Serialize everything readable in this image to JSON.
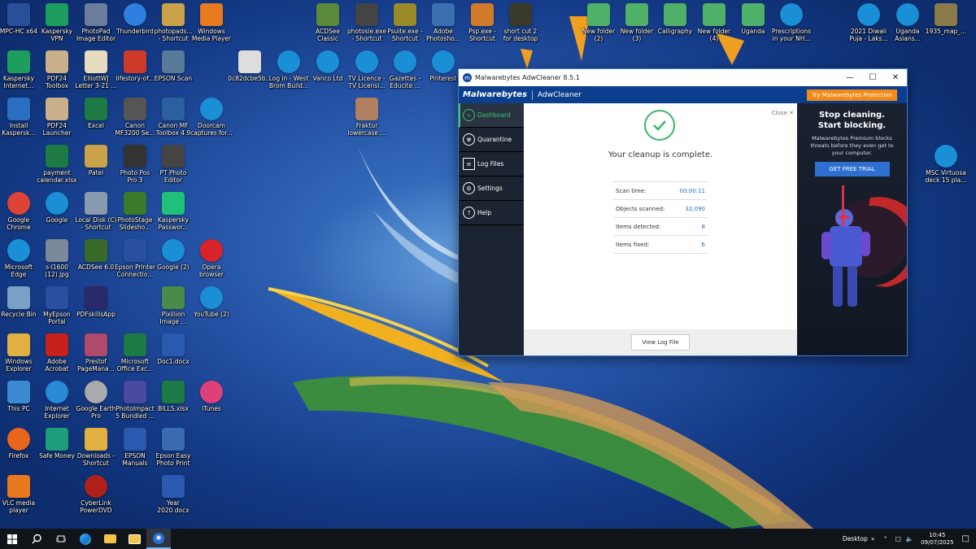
{
  "window": {
    "title": "Malwarebytes AdwCleaner 8.5.1",
    "brand": "Malwarebytes",
    "product": "AdwCleaner",
    "try_button": "Try Malwarebytes Protection",
    "nav": [
      {
        "label": "Dashboard",
        "icon": "dashboard-icon",
        "active": true
      },
      {
        "label": "Quarantine",
        "icon": "quarantine-icon",
        "active": false
      },
      {
        "label": "Log Files",
        "icon": "log-files-icon",
        "active": false
      },
      {
        "label": "Settings",
        "icon": "settings-icon",
        "active": false
      },
      {
        "label": "Help",
        "icon": "help-icon",
        "active": false
      }
    ],
    "close_link": "Close",
    "status": "Your cleanup is complete.",
    "stats": [
      {
        "label": "Scan time:",
        "value": "00:00:11"
      },
      {
        "label": "Objects scanned:",
        "value": "32,090"
      },
      {
        "label": "Items detected:",
        "value": "8"
      },
      {
        "label": "Items fixed:",
        "value": "6"
      }
    ],
    "view_log_button": "View Log File",
    "ad": {
      "headline1": "Stop cleaning.",
      "headline2": "Start blocking.",
      "body": "Malwarebytes Premium blocks threats before they even get to your computer.",
      "cta": "GET FREE TRIAL"
    },
    "colors": {
      "header": "#0b3e8c",
      "accent_green": "#3ab66a",
      "try_orange": "#f08a18",
      "sidebar": "#1c2431"
    }
  },
  "desktop_icons": [
    {
      "label": "MPC-HC x64",
      "icon": "mpc-hc-icon",
      "color": "#2a4f9a"
    },
    {
      "label": "Kaspersky\nVPN",
      "icon": "kaspersky-vpn-icon",
      "color": "#1e9e5e"
    },
    {
      "label": "PhotoPad\nImage Editor",
      "icon": "photopad-icon",
      "color": "#6a7d9c"
    },
    {
      "label": "Thunderbird",
      "icon": "thunderbird-icon",
      "color": "#2f7fe0"
    },
    {
      "label": "photopads...\n- Shortcut",
      "icon": "folder-icon",
      "color": "#c9a24a"
    },
    {
      "label": "Windows\nMedia Player",
      "icon": "media-player-icon",
      "color": "#e8791e"
    },
    {
      "label": "ACDSee\nClassic",
      "icon": "acdsee-icon",
      "color": "#5a8a3a"
    },
    {
      "label": "photosie.exe\n- Shortcut",
      "icon": "eye-icon",
      "color": "#444"
    },
    {
      "label": "Psuite.exe -\nShortcut",
      "icon": "psuite-icon",
      "color": "#9a8a2a"
    },
    {
      "label": "Adobe\nPhotosho...",
      "icon": "camera-icon",
      "color": "#3a6fb0"
    },
    {
      "label": "Psp.exe -\nShortcut",
      "icon": "psp-icon",
      "color": "#d07a2a"
    },
    {
      "label": "short cut 2\nfor desktop",
      "icon": "shortcut-icon",
      "color": "#3a3a2a"
    },
    {
      "label": "New folder\n(2)",
      "icon": "folder-icon",
      "color": "#4fb06a"
    },
    {
      "label": "New folder\n(3)",
      "icon": "folder-icon",
      "color": "#4fb06a"
    },
    {
      "label": "Calligraphy",
      "icon": "folder-icon",
      "color": "#4fb06a"
    },
    {
      "label": "New folder\n(4)",
      "icon": "folder-icon",
      "color": "#4fb06a"
    },
    {
      "label": "Uganda",
      "icon": "folder-icon",
      "color": "#4fb06a"
    },
    {
      "label": "Prescriptions\nin your NH...",
      "icon": "edge-icon",
      "color": "#1a8fd6"
    },
    {
      "label": "2021 Diwali\nPuja - Laks...",
      "icon": "edge-icon",
      "color": "#1a8fd6"
    },
    {
      "label": "Uganda\nAsians...",
      "icon": "edge-icon",
      "color": "#1a8fd6"
    },
    {
      "label": "1935_map_...",
      "icon": "map-icon",
      "color": "#8a7a4a"
    },
    {
      "label": "Kaspersky\nInternet...",
      "icon": "kaspersky-icon",
      "color": "#1e9e5e"
    },
    {
      "label": "PDF24\nToolbox",
      "icon": "pdf24-icon",
      "color": "#c9b08a"
    },
    {
      "label": "ElliottWJ\nLetter 3-21 ...",
      "icon": "document-icon",
      "color": "#e8dcc0"
    },
    {
      "label": "lifestory-of...",
      "icon": "pdf-icon",
      "color": "#d03a2a"
    },
    {
      "label": "EPSON Scan",
      "icon": "scanner-icon",
      "color": "#5a7a9a"
    },
    {
      "label": "0c82dcbe5b...",
      "icon": "image-icon",
      "color": "#ddd"
    },
    {
      "label": "Log in - West\nBrom Build...",
      "icon": "edge-icon",
      "color": "#1a8fd6"
    },
    {
      "label": "Vanco Ltd",
      "icon": "edge-icon",
      "color": "#1a8fd6"
    },
    {
      "label": "TV Licence -\nTV Licensi...",
      "icon": "edge-icon",
      "color": "#1a8fd6"
    },
    {
      "label": "Gazettes -\nEducite ...",
      "icon": "edge-icon",
      "color": "#1a8fd6"
    },
    {
      "label": "Pinterest",
      "icon": "edge-icon",
      "color": "#1a8fd6"
    },
    {
      "label": "Install\nKaspersk...",
      "icon": "installer-icon",
      "color": "#2a6fc0"
    },
    {
      "label": "PDF24\nLauncher",
      "icon": "pdf24-icon",
      "color": "#c9b08a"
    },
    {
      "label": "Excel",
      "icon": "excel-icon",
      "color": "#1d7a45"
    },
    {
      "label": "Canon\nMF3200 Se...",
      "icon": "printer-icon",
      "color": "#555"
    },
    {
      "label": "Canon MF\nToolbox 4.9",
      "icon": "toolbox-icon",
      "color": "#2a5fa0"
    },
    {
      "label": "Doorcam\ncaptures for...",
      "icon": "edge-icon",
      "color": "#1a8fd6"
    },
    {
      "label": "Fraktur\nlowercase ...",
      "icon": "image-icon",
      "color": "#b08060"
    },
    {
      "label": "payment\ncalendar.xlsx",
      "icon": "excel-file-icon",
      "color": "#1d7a45"
    },
    {
      "label": "Patel",
      "icon": "user-folder-icon",
      "color": "#c9a24a"
    },
    {
      "label": "Photo Pos\nPro 3",
      "icon": "photopos-icon",
      "color": "#333"
    },
    {
      "label": "PT Photo\nEditor",
      "icon": "pt-photo-icon",
      "color": "#444"
    },
    {
      "label": "MSC Virtuosa\ndeck 15 pla...",
      "icon": "edge-icon",
      "color": "#1a8fd6"
    },
    {
      "label": "Google\nChrome",
      "icon": "chrome-icon",
      "color": "#db4437"
    },
    {
      "label": "Google",
      "icon": "edge-icon",
      "color": "#1a8fd6"
    },
    {
      "label": "Local Disk (C)\n- Shortcut",
      "icon": "disk-icon",
      "color": "#8a9ab0"
    },
    {
      "label": "PhotoStage\nSlidesho...",
      "icon": "photostage-icon",
      "color": "#3a7a2a"
    },
    {
      "label": "Kaspersky\nPasswor...",
      "icon": "kaspersky-password-icon",
      "color": "#1ec07a"
    },
    {
      "label": "Microsoft\nEdge",
      "icon": "edge-icon",
      "color": "#1a8fd6"
    },
    {
      "label": "s-l1600\n(12).jpg",
      "icon": "image-icon",
      "color": "#7a8a9a"
    },
    {
      "label": "ACDSee 6.0",
      "icon": "acdsee-icon",
      "color": "#3a6a2a"
    },
    {
      "label": "Epson Printer\nConnectio...",
      "icon": "epson-icon",
      "color": "#2a4fa0"
    },
    {
      "label": "Google (2)",
      "icon": "edge-icon",
      "color": "#1a8fd6"
    },
    {
      "label": "Opera\nbrowser",
      "icon": "opera-icon",
      "color": "#d8232a"
    },
    {
      "label": "Recycle Bin",
      "icon": "recycle-bin-icon",
      "color": "#7aa0c8"
    },
    {
      "label": "MyEpson\nPortal",
      "icon": "myepson-icon",
      "color": "#2a4fa0"
    },
    {
      "label": "PDFskillsApp",
      "icon": "pdfskills-icon",
      "color": "#2a2a6a"
    },
    {
      "label": "Pixillion\nImage ...",
      "icon": "pixillion-icon",
      "color": "#4a8a4a"
    },
    {
      "label": "YouTube (2)",
      "icon": "edge-icon",
      "color": "#1a8fd6"
    },
    {
      "label": "Windows\nExplorer",
      "icon": "explorer-icon",
      "color": "#e0b040"
    },
    {
      "label": "Adobe\nAcrobat",
      "icon": "acrobat-icon",
      "color": "#c8201a"
    },
    {
      "label": "Prestof\nPageMana...",
      "icon": "prestof-icon",
      "color": "#b04a6a"
    },
    {
      "label": "Microsoft\nOffice Exc...",
      "icon": "excel-icon",
      "color": "#1d7a45"
    },
    {
      "label": "Doc1.docx",
      "icon": "word-file-icon",
      "color": "#2a5ab0"
    },
    {
      "label": "This PC",
      "icon": "this-pc-icon",
      "color": "#3a8ad0"
    },
    {
      "label": "Internet\nExplorer",
      "icon": "internet-explorer-icon",
      "color": "#2a8ad8"
    },
    {
      "label": "Google Earth\nPro",
      "icon": "google-earth-icon",
      "color": "#aaa"
    },
    {
      "label": "PhotoImpact\n5 Bundled ...",
      "icon": "photoimpact-icon",
      "color": "#4a4aa0"
    },
    {
      "label": "BILLS.xlsx",
      "icon": "excel-file-icon",
      "color": "#1d7a45"
    },
    {
      "label": "iTunes",
      "icon": "itunes-icon",
      "color": "#e0407a"
    },
    {
      "label": "Firefox",
      "icon": "firefox-icon",
      "color": "#e8651e"
    },
    {
      "label": "Safe Money",
      "icon": "safe-money-icon",
      "color": "#1e9e7a"
    },
    {
      "label": "Downloads -\nShortcut",
      "icon": "downloads-folder-icon",
      "color": "#e0b040"
    },
    {
      "label": "EPSON\nManuals",
      "icon": "epson-manuals-icon",
      "color": "#2a5ab0"
    },
    {
      "label": "Epson Easy\nPhoto Print",
      "icon": "epson-photo-print-icon",
      "color": "#3a6ab0"
    },
    {
      "label": "VLC media\nplayer",
      "icon": "vlc-icon",
      "color": "#e8781e"
    },
    {
      "label": "CyberLink\nPowerDVD",
      "icon": "powerdvd-icon",
      "color": "#b0201a"
    },
    {
      "label": "Year\n2020.docx",
      "icon": "word-file-icon",
      "color": "#2a5ab0"
    }
  ],
  "taskbar": {
    "items": [
      {
        "name": "start-button",
        "icon": "windows-icon"
      },
      {
        "name": "search-button",
        "icon": "search-icon"
      },
      {
        "name": "task-view-button",
        "icon": "task-view-icon"
      },
      {
        "name": "edge-taskbar",
        "icon": "edge-icon"
      },
      {
        "name": "file-explorer-taskbar",
        "icon": "folder-icon"
      },
      {
        "name": "explorer-taskbar-2",
        "icon": "folder-icon"
      },
      {
        "name": "adwcleaner-taskbar",
        "icon": "adwcleaner-icon"
      }
    ],
    "desktop_label": "Desktop",
    "time": "10:45",
    "date": "09/07/2025"
  }
}
